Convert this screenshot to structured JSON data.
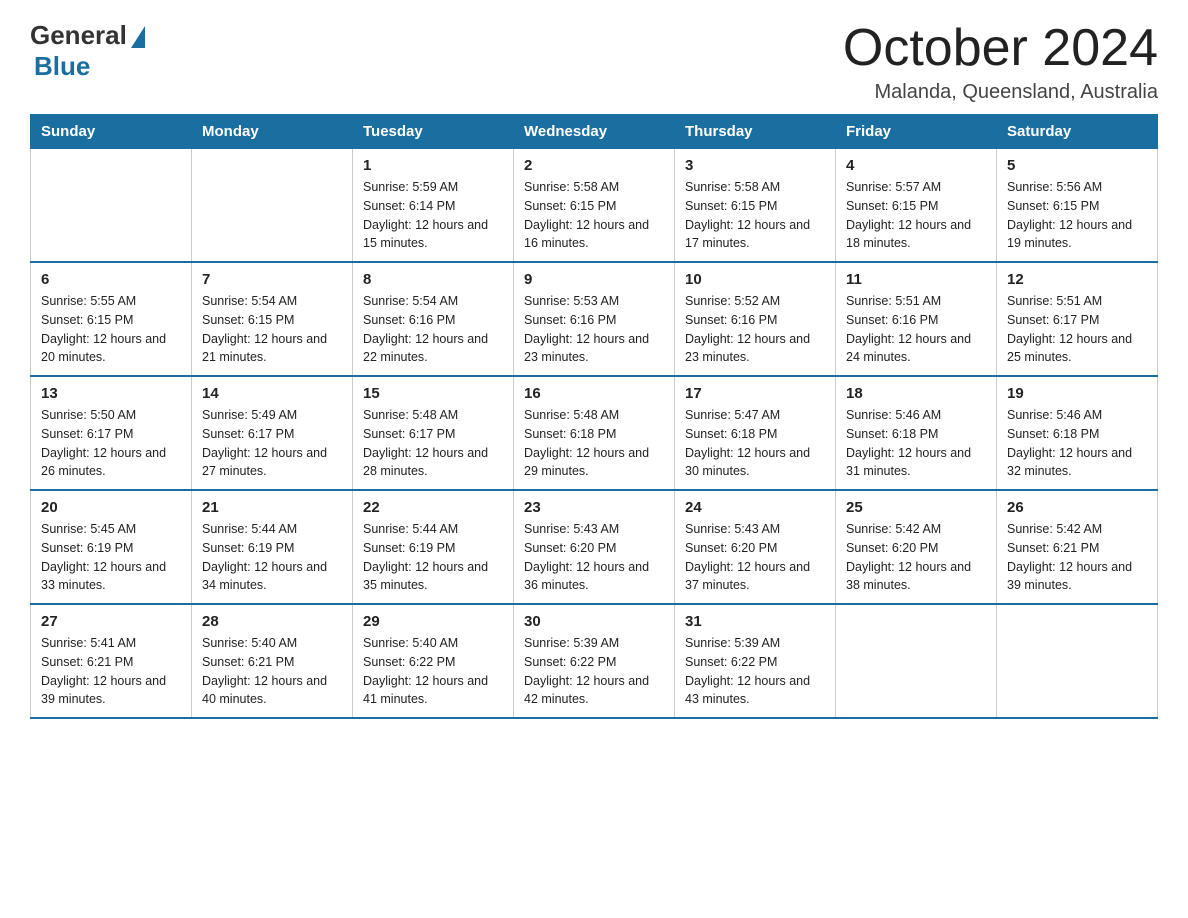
{
  "logo": {
    "general": "General",
    "blue": "Blue"
  },
  "title": "October 2024",
  "subtitle": "Malanda, Queensland, Australia",
  "days_of_week": [
    "Sunday",
    "Monday",
    "Tuesday",
    "Wednesday",
    "Thursday",
    "Friday",
    "Saturday"
  ],
  "weeks": [
    [
      {
        "day": "",
        "detail": ""
      },
      {
        "day": "",
        "detail": ""
      },
      {
        "day": "1",
        "detail": "Sunrise: 5:59 AM\nSunset: 6:14 PM\nDaylight: 12 hours and 15 minutes."
      },
      {
        "day": "2",
        "detail": "Sunrise: 5:58 AM\nSunset: 6:15 PM\nDaylight: 12 hours and 16 minutes."
      },
      {
        "day": "3",
        "detail": "Sunrise: 5:58 AM\nSunset: 6:15 PM\nDaylight: 12 hours and 17 minutes."
      },
      {
        "day": "4",
        "detail": "Sunrise: 5:57 AM\nSunset: 6:15 PM\nDaylight: 12 hours and 18 minutes."
      },
      {
        "day": "5",
        "detail": "Sunrise: 5:56 AM\nSunset: 6:15 PM\nDaylight: 12 hours and 19 minutes."
      }
    ],
    [
      {
        "day": "6",
        "detail": "Sunrise: 5:55 AM\nSunset: 6:15 PM\nDaylight: 12 hours and 20 minutes."
      },
      {
        "day": "7",
        "detail": "Sunrise: 5:54 AM\nSunset: 6:15 PM\nDaylight: 12 hours and 21 minutes."
      },
      {
        "day": "8",
        "detail": "Sunrise: 5:54 AM\nSunset: 6:16 PM\nDaylight: 12 hours and 22 minutes."
      },
      {
        "day": "9",
        "detail": "Sunrise: 5:53 AM\nSunset: 6:16 PM\nDaylight: 12 hours and 23 minutes."
      },
      {
        "day": "10",
        "detail": "Sunrise: 5:52 AM\nSunset: 6:16 PM\nDaylight: 12 hours and 23 minutes."
      },
      {
        "day": "11",
        "detail": "Sunrise: 5:51 AM\nSunset: 6:16 PM\nDaylight: 12 hours and 24 minutes."
      },
      {
        "day": "12",
        "detail": "Sunrise: 5:51 AM\nSunset: 6:17 PM\nDaylight: 12 hours and 25 minutes."
      }
    ],
    [
      {
        "day": "13",
        "detail": "Sunrise: 5:50 AM\nSunset: 6:17 PM\nDaylight: 12 hours and 26 minutes."
      },
      {
        "day": "14",
        "detail": "Sunrise: 5:49 AM\nSunset: 6:17 PM\nDaylight: 12 hours and 27 minutes."
      },
      {
        "day": "15",
        "detail": "Sunrise: 5:48 AM\nSunset: 6:17 PM\nDaylight: 12 hours and 28 minutes."
      },
      {
        "day": "16",
        "detail": "Sunrise: 5:48 AM\nSunset: 6:18 PM\nDaylight: 12 hours and 29 minutes."
      },
      {
        "day": "17",
        "detail": "Sunrise: 5:47 AM\nSunset: 6:18 PM\nDaylight: 12 hours and 30 minutes."
      },
      {
        "day": "18",
        "detail": "Sunrise: 5:46 AM\nSunset: 6:18 PM\nDaylight: 12 hours and 31 minutes."
      },
      {
        "day": "19",
        "detail": "Sunrise: 5:46 AM\nSunset: 6:18 PM\nDaylight: 12 hours and 32 minutes."
      }
    ],
    [
      {
        "day": "20",
        "detail": "Sunrise: 5:45 AM\nSunset: 6:19 PM\nDaylight: 12 hours and 33 minutes."
      },
      {
        "day": "21",
        "detail": "Sunrise: 5:44 AM\nSunset: 6:19 PM\nDaylight: 12 hours and 34 minutes."
      },
      {
        "day": "22",
        "detail": "Sunrise: 5:44 AM\nSunset: 6:19 PM\nDaylight: 12 hours and 35 minutes."
      },
      {
        "day": "23",
        "detail": "Sunrise: 5:43 AM\nSunset: 6:20 PM\nDaylight: 12 hours and 36 minutes."
      },
      {
        "day": "24",
        "detail": "Sunrise: 5:43 AM\nSunset: 6:20 PM\nDaylight: 12 hours and 37 minutes."
      },
      {
        "day": "25",
        "detail": "Sunrise: 5:42 AM\nSunset: 6:20 PM\nDaylight: 12 hours and 38 minutes."
      },
      {
        "day": "26",
        "detail": "Sunrise: 5:42 AM\nSunset: 6:21 PM\nDaylight: 12 hours and 39 minutes."
      }
    ],
    [
      {
        "day": "27",
        "detail": "Sunrise: 5:41 AM\nSunset: 6:21 PM\nDaylight: 12 hours and 39 minutes."
      },
      {
        "day": "28",
        "detail": "Sunrise: 5:40 AM\nSunset: 6:21 PM\nDaylight: 12 hours and 40 minutes."
      },
      {
        "day": "29",
        "detail": "Sunrise: 5:40 AM\nSunset: 6:22 PM\nDaylight: 12 hours and 41 minutes."
      },
      {
        "day": "30",
        "detail": "Sunrise: 5:39 AM\nSunset: 6:22 PM\nDaylight: 12 hours and 42 minutes."
      },
      {
        "day": "31",
        "detail": "Sunrise: 5:39 AM\nSunset: 6:22 PM\nDaylight: 12 hours and 43 minutes."
      },
      {
        "day": "",
        "detail": ""
      },
      {
        "day": "",
        "detail": ""
      }
    ]
  ]
}
